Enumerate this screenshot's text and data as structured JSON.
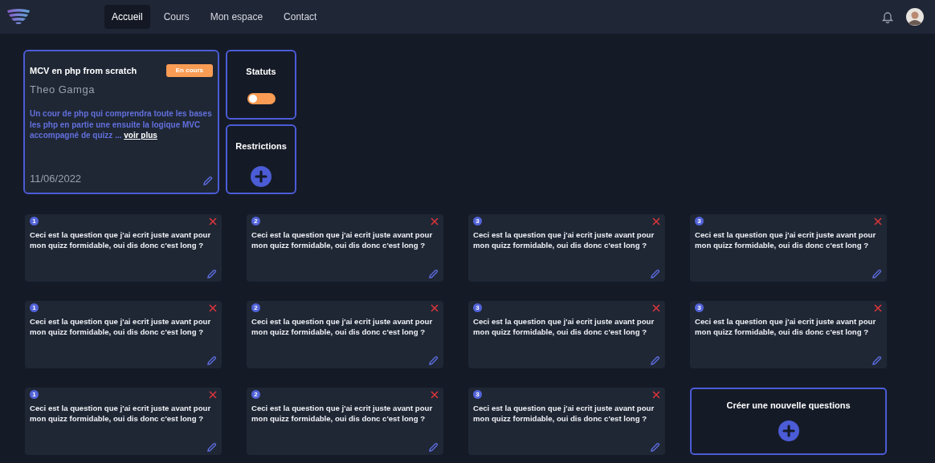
{
  "navbar": {
    "links": [
      {
        "label": "Accueil",
        "selected": true
      },
      {
        "label": "Cours",
        "selected": false
      },
      {
        "label": "Mon espace",
        "selected": false
      },
      {
        "label": "Contact",
        "selected": false
      }
    ]
  },
  "course": {
    "title": "MCV en php from scratch",
    "badge": "En cours",
    "author": "Theo Gamga",
    "description": "Un cour de php qui comprendra toute les bases les php en partie une ensuite la logique MVC accompagné de quizz ...",
    "more_link": "voir plus",
    "date": "11/06/2022"
  },
  "status": {
    "title": "Statuts",
    "on": false
  },
  "restrictions": {
    "title": "Restrictions"
  },
  "questions": [
    {
      "number": "1",
      "text": "Ceci est la question que j'ai ecrit juste avant pour mon quizz formidable, oui dis donc c'est long ?"
    },
    {
      "number": "2",
      "text": "Ceci est la question que j'ai ecrit juste avant pour mon quizz formidable, oui dis donc c'est long ?"
    },
    {
      "number": "3",
      "text": "Ceci est la question que j'ai ecrit juste avant pour mon quizz formidable, oui dis donc c'est long ?"
    },
    {
      "number": "3",
      "text": "Ceci est la question que j'ai ecrit juste avant pour mon quizz formidable, oui dis donc c'est long ?"
    },
    {
      "number": "1",
      "text": "Ceci est la question que j'ai ecrit juste avant pour mon quizz formidable, oui dis donc c'est long ?"
    },
    {
      "number": "2",
      "text": "Ceci est la question que j'ai ecrit juste avant pour mon quizz formidable, oui dis donc c'est long ?"
    },
    {
      "number": "3",
      "text": "Ceci est la question que j'ai ecrit juste avant pour mon quizz formidable, oui dis donc c'est long ?"
    },
    {
      "number": "3",
      "text": "Ceci est la question que j'ai ecrit juste avant pour mon quizz formidable, oui dis donc c'est long ?"
    },
    {
      "number": "1",
      "text": "Ceci est la question que j'ai ecrit juste avant pour mon quizz formidable, oui dis donc c'est long ?"
    },
    {
      "number": "2",
      "text": "Ceci est la question que j'ai ecrit juste avant pour mon quizz formidable, oui dis donc c'est long ?"
    },
    {
      "number": "3",
      "text": "Ceci est la question que j'ai ecrit juste avant pour mon quizz formidable, oui dis donc c'est long ?"
    }
  ],
  "new_question": {
    "title": "Créer une nouvelle questions"
  }
}
